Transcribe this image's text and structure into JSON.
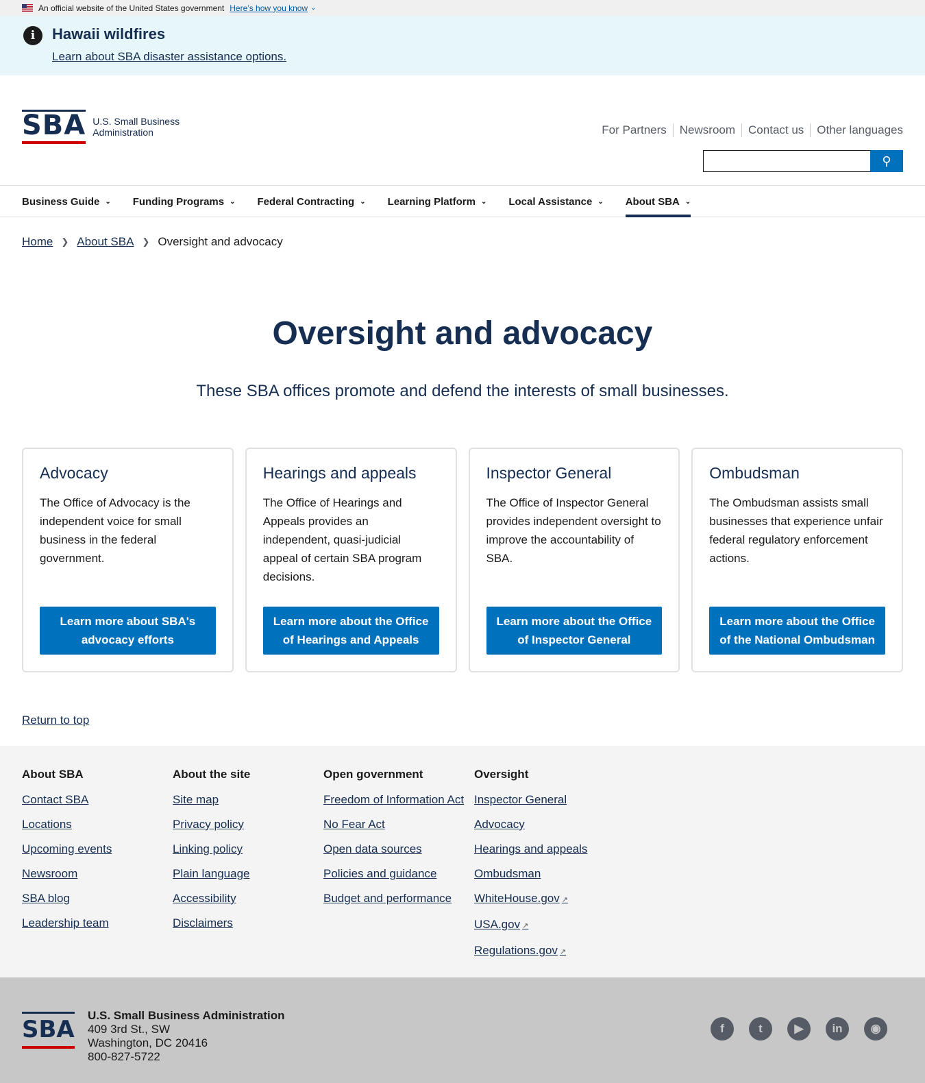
{
  "gov_banner": {
    "text": "An official website of the United States government",
    "link": "Here’s how you know"
  },
  "alert": {
    "title": "Hawaii wildfires",
    "link": "Learn about SBA disaster assistance options."
  },
  "logo": {
    "mark": "SBA",
    "line1": "U.S. Small Business",
    "line2": "Administration"
  },
  "utility_links": [
    "For Partners",
    "Newsroom",
    "Contact us",
    "Other languages"
  ],
  "search": {
    "placeholder": ""
  },
  "nav": [
    "Business Guide",
    "Funding Programs",
    "Federal Contracting",
    "Learning Platform",
    "Local Assistance",
    "About SBA"
  ],
  "breadcrumb": [
    "Home",
    "About SBA",
    "Oversight and advocacy"
  ],
  "hero": {
    "title": "Oversight and advocacy",
    "subtitle": "These SBA offices promote and defend the interests of small businesses."
  },
  "cards": [
    {
      "title": "Advocacy",
      "body": "The Office of Advocacy is the independent voice for small business in the federal government.",
      "button": "Learn more about SBA's advocacy efforts"
    },
    {
      "title": "Hearings and appeals",
      "body": "The Office of Hearings and Appeals provides an independent, quasi-judicial appeal of certain SBA program decisions.",
      "button": "Learn more about the Office of Hearings and Appeals"
    },
    {
      "title": "Inspector General",
      "body": "The Office of Inspector General provides independent oversight to improve the accountability of SBA.",
      "button": "Learn more about the Office of Inspector General"
    },
    {
      "title": "Ombudsman",
      "body": "The Ombudsman assists small businesses that experience unfair federal regulatory enforcement actions.",
      "button": "Learn more about the Office of the National Ombudsman"
    }
  ],
  "return_to_top": "Return to top",
  "footer": [
    {
      "heading": "About SBA",
      "links": [
        "Contact SBA",
        "Locations",
        "Upcoming events",
        "Newsroom",
        "SBA blog",
        "Leadership team"
      ]
    },
    {
      "heading": "About the site",
      "links": [
        "Site map",
        "Privacy policy",
        "Linking policy",
        "Plain language",
        "Accessibility",
        "Disclaimers"
      ]
    },
    {
      "heading": "Open government",
      "links": [
        "Freedom of Information Act",
        "No Fear Act",
        "Open data sources",
        "Policies and guidance",
        "Budget and performance"
      ]
    },
    {
      "heading": "Oversight",
      "links": [
        "Inspector General",
        "Advocacy",
        "Hearings and appeals",
        "Ombudsman",
        "WhiteHouse.gov",
        "USA.gov",
        "Regulations.gov"
      ]
    }
  ],
  "address": {
    "name": "U.S. Small Business Administration",
    "street": "409 3rd St., SW",
    "city": "Washington, DC 20416",
    "phone": "800-827-5722"
  },
  "social": [
    "facebook-icon",
    "twitter-icon",
    "youtube-icon",
    "linkedin-icon",
    "instagram-icon"
  ],
  "colors": {
    "primary": "#162e51",
    "button": "#0071bc",
    "accent_red": "#cc0000"
  }
}
